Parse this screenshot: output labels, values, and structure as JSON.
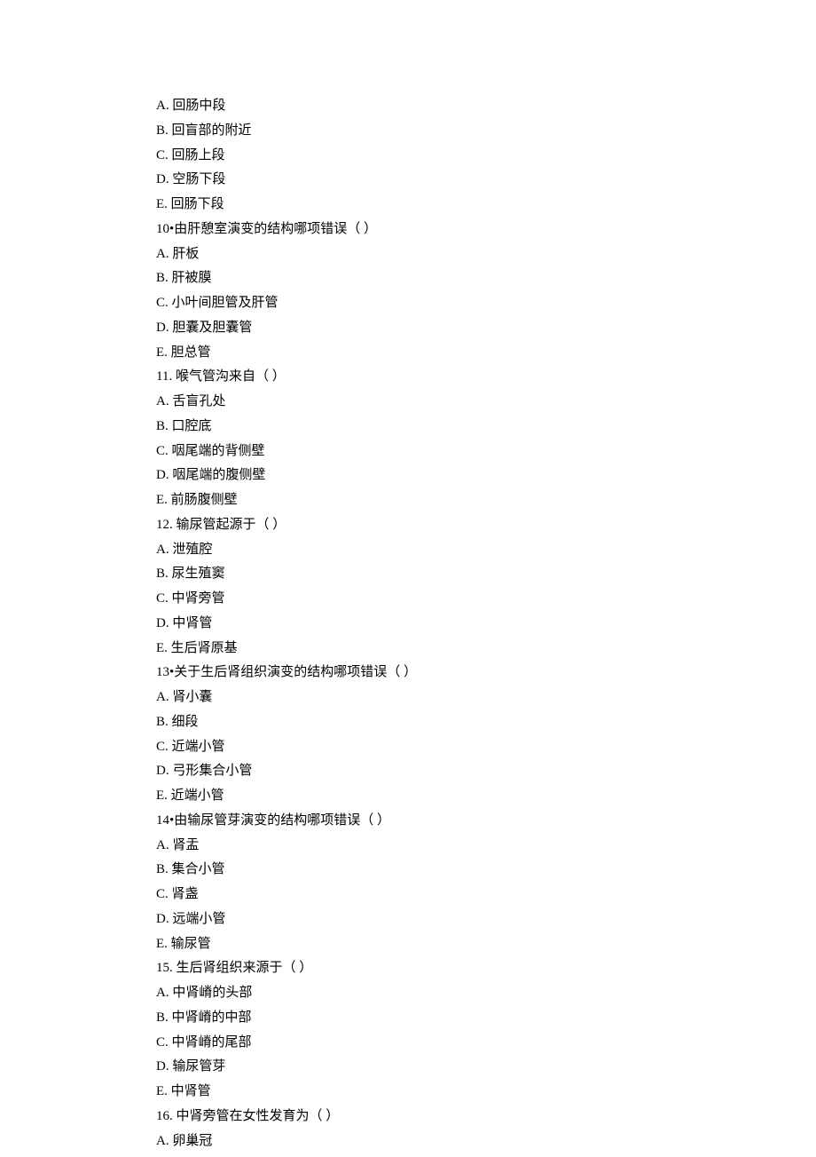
{
  "lines": [
    "A.  回肠中段",
    "B.  回盲部的附近",
    "C.  回肠上段",
    "D.  空肠下段",
    "E.  回肠下段",
    "10•由肝憩室演变的结构哪项错误（ ）",
    "A.  肝板",
    "B.  肝被膜",
    "C.  小叶间胆管及肝管",
    "D.  胆囊及胆囊管",
    "E.  胆总管",
    "11.  喉气管沟来自（ ）",
    "A.  舌盲孔处",
    "B.  口腔底",
    "C.  咽尾端的背侧壁",
    "D.  咽尾端的腹侧壁",
    "E.  前肠腹侧壁",
    "12.  输尿管起源于（ ）",
    "A.  泄殖腔",
    "B.  尿生殖窦",
    "C.  中肾旁管",
    "D.  中肾管",
    "E.  生后肾原基",
    "13•关于生后肾组织演变的结构哪项错误（ ）",
    "A.  肾小囊",
    "B.  细段",
    "C.  近端小管",
    "D.  弓形集合小管",
    "E.  近端小管",
    "14•由输尿管芽演变的结构哪项错误（ ）",
    "A.  肾盂",
    "B.  集合小管",
    "C.  肾盏",
    "D.  远端小管",
    "E.  输尿管",
    "15.  生后肾组织来源于（ ）",
    "A.  中肾嵴的头部",
    "B.  中肾嵴的中部",
    "C.  中肾嵴的尾部",
    "D.  输尿管芽",
    "E.  中肾管",
    "16.  中肾旁管在女性发育为（ ）",
    "A.  卵巢冠"
  ]
}
